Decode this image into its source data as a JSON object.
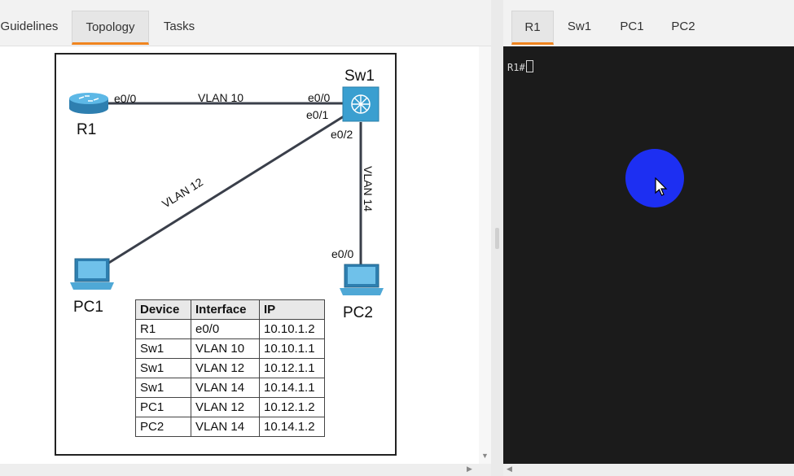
{
  "left_tabs": [
    {
      "label": "Guidelines",
      "active": false
    },
    {
      "label": "Topology",
      "active": true
    },
    {
      "label": "Tasks",
      "active": false
    }
  ],
  "right_tabs": [
    {
      "label": "R1",
      "active": true
    },
    {
      "label": "Sw1",
      "active": false
    },
    {
      "label": "PC1",
      "active": false
    },
    {
      "label": "PC2",
      "active": false
    }
  ],
  "topology": {
    "devices": {
      "r1": "R1",
      "sw1": "Sw1",
      "pc1": "PC1",
      "pc2": "PC2"
    },
    "links": {
      "r1_sw1": {
        "vlan": "VLAN 10",
        "r1_port": "e0/0",
        "sw1_port": "e0/0"
      },
      "sw1_pc1": {
        "vlan": "VLAN 12",
        "sw1_port": "e0/1"
      },
      "sw1_pc2": {
        "vlan": "VLAN 14",
        "sw1_port": "e0/2",
        "pc2_port": "e0/0"
      }
    },
    "table": {
      "headers": [
        "Device",
        "Interface",
        "IP"
      ],
      "rows": [
        [
          "R1",
          "e0/0",
          "10.10.1.2"
        ],
        [
          "Sw1",
          "VLAN 10",
          "10.10.1.1"
        ],
        [
          "Sw1",
          "VLAN 12",
          "10.12.1.1"
        ],
        [
          "Sw1",
          "VLAN 14",
          "10.14.1.1"
        ],
        [
          "PC1",
          "VLAN 12",
          "10.12.1.2"
        ],
        [
          "PC2",
          "VLAN 14",
          "10.14.1.2"
        ]
      ]
    }
  },
  "terminal": {
    "prompt": "R1#"
  },
  "colors": {
    "tab_accent": "#f0841f",
    "terminal_bg": "#1b1b1b",
    "click_indicator": "#1d2ff2",
    "device_blue": "#3a9fd0"
  }
}
